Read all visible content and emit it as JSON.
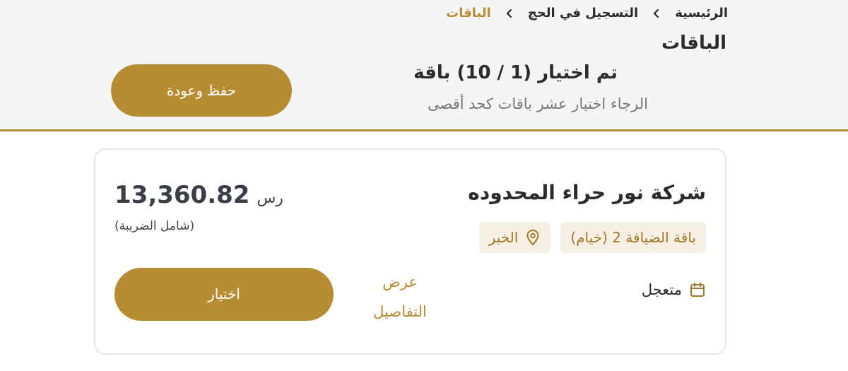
{
  "breadcrumb": {
    "items": [
      "الرئيسية",
      "التسجيل في الحج",
      "الباقات"
    ]
  },
  "page_title": "الباقات",
  "selection": {
    "count_text": "تم اختيار (1 / 10) باقة",
    "hint": "الرجاء اختيار عشر باقات كحد أقصى"
  },
  "actions": {
    "save_back_label": "حفظ وعودة"
  },
  "package_card": {
    "company": "شركة نور حراء المحدوده",
    "package_tag": "باقة الضيافة 2 (خيام)",
    "location_tag": "الخبر",
    "location_icon": "map-pin-icon",
    "price": "13,360.82",
    "currency": "رس",
    "tax_note": "(شامل الضريبة)",
    "departure": "متعجل",
    "departure_icon": "calendar-icon",
    "details_label": "عرض التفاصيل",
    "select_label": "اختيار"
  },
  "colors": {
    "accent": "#b78d34",
    "tag_bg": "#f6efe3",
    "band_bg": "#f5f5f5"
  }
}
